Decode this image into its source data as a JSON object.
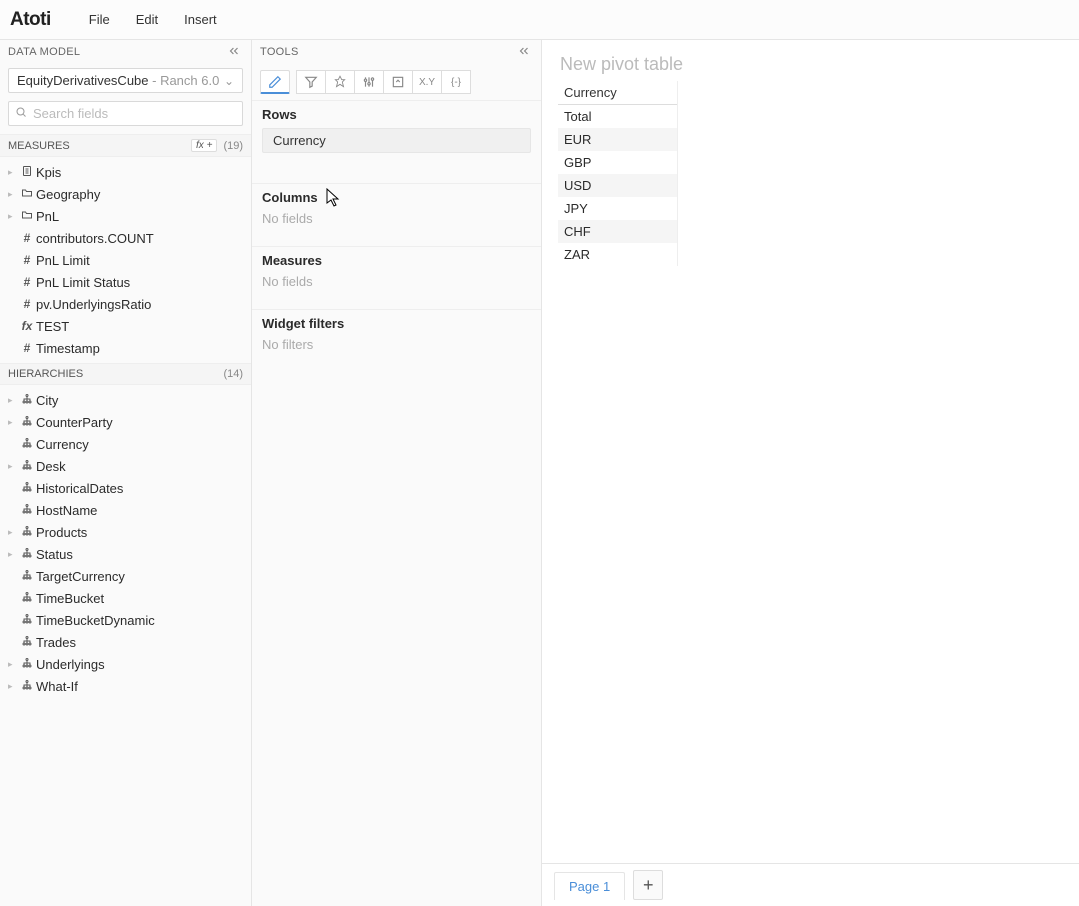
{
  "app": {
    "logo": "Atoti"
  },
  "menu": {
    "file": "File",
    "edit": "Edit",
    "insert": "Insert"
  },
  "left": {
    "dataModelTitle": "DATA MODEL",
    "cubeName": "EquityDerivativesCube",
    "cubeSuffix": " - Ranch 6.0",
    "searchPlaceholder": "Search fields",
    "measuresTitle": "MEASURES",
    "measuresCount": "(19)",
    "fxLabel": "fx +",
    "measures": [
      {
        "icon": "kpi",
        "label": "Kpis",
        "caret": true
      },
      {
        "icon": "folder",
        "label": "Geography",
        "caret": true
      },
      {
        "icon": "folder",
        "label": "PnL",
        "caret": true
      },
      {
        "icon": "hash",
        "label": "contributors.COUNT",
        "caret": false
      },
      {
        "icon": "hash",
        "label": "PnL Limit",
        "caret": false
      },
      {
        "icon": "hash",
        "label": "PnL Limit Status",
        "caret": false
      },
      {
        "icon": "hash",
        "label": "pv.UnderlyingsRatio",
        "caret": false
      },
      {
        "icon": "fx",
        "label": "TEST",
        "caret": false
      },
      {
        "icon": "hash",
        "label": "Timestamp",
        "caret": false
      }
    ],
    "hierTitle": "HIERARCHIES",
    "hierCount": "(14)",
    "hierarchies": [
      {
        "label": "City",
        "caret": true
      },
      {
        "label": "CounterParty",
        "caret": true
      },
      {
        "label": "Currency",
        "caret": false
      },
      {
        "label": "Desk",
        "caret": true
      },
      {
        "label": "HistoricalDates",
        "caret": false
      },
      {
        "label": "HostName",
        "caret": false
      },
      {
        "label": "Products",
        "caret": true
      },
      {
        "label": "Status",
        "caret": true
      },
      {
        "label": "TargetCurrency",
        "caret": false
      },
      {
        "label": "TimeBucket",
        "caret": false
      },
      {
        "label": "TimeBucketDynamic",
        "caret": false
      },
      {
        "label": "Trades",
        "caret": false
      },
      {
        "label": "Underlyings",
        "caret": true
      },
      {
        "label": "What-If",
        "caret": true
      }
    ]
  },
  "tools": {
    "headerTitle": "TOOLS",
    "tabs": {
      "xy": "X.Y",
      "braces": "{-}"
    },
    "rowsTitle": "Rows",
    "rowsChip": "Currency",
    "colsTitle": "Columns",
    "colsEmpty": "No fields",
    "measTitle": "Measures",
    "measEmpty": "No fields",
    "filtTitle": "Widget filters",
    "filtEmpty": "No filters"
  },
  "main": {
    "pivotTitle": "New pivot table",
    "columnHeader": "Currency",
    "rows": [
      "Total",
      "EUR",
      "GBP",
      "USD",
      "JPY",
      "CHF",
      "ZAR"
    ],
    "pageTab": "Page 1"
  }
}
